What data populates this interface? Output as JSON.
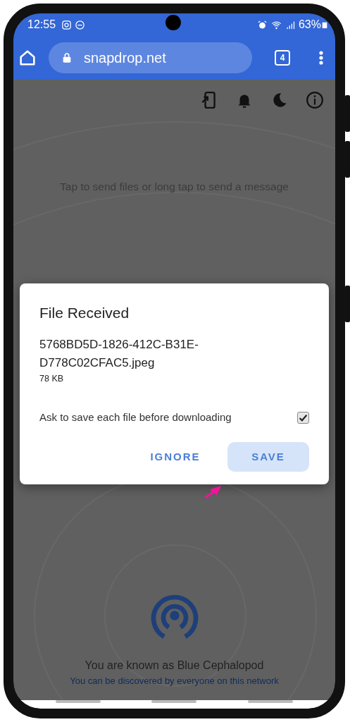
{
  "status_bar": {
    "time": "12:55",
    "battery": "63%"
  },
  "browser": {
    "url": "snapdrop.net",
    "tab_count": "4"
  },
  "hint": "Tap to send files or long tap to send a message",
  "dialog": {
    "title": "File Received",
    "file_name": "5768BD5D-1826-412C-B31E-D778C02CFAC5.jpeg",
    "file_size": "78 KB",
    "option": {
      "label": "Ask to save each file before downloading",
      "checked": true
    },
    "buttons": [
      {
        "label": "IGNORE",
        "focused": false
      },
      {
        "label": "SAVE",
        "focused": true
      }
    ]
  },
  "footer": {
    "name": "You are known as Blue Cephalopod",
    "note": "You can be discovered by everyone on this network"
  }
}
